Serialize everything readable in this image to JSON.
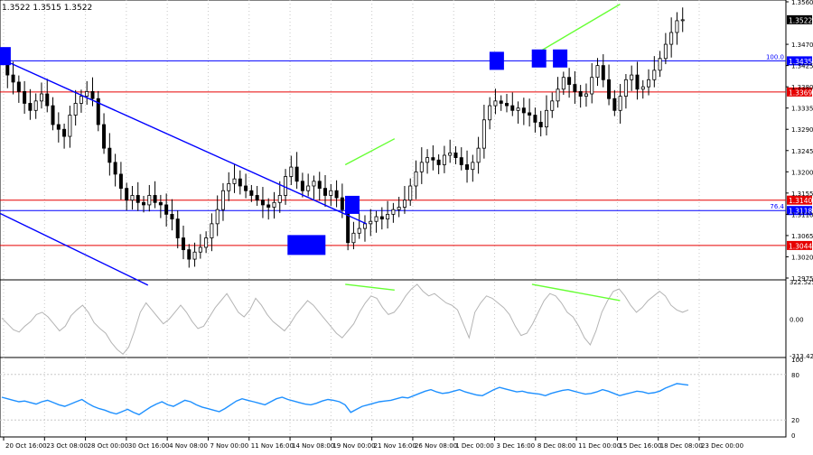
{
  "header": {
    "ohlc_text": "1.3522 1.3515 1.3522"
  },
  "colors": {
    "candle": "#000000",
    "blue_line": "#0000ff",
    "red_line": "#c8102e",
    "green_line": "#66ff33",
    "marker_fill": "#0000ff",
    "osc1_line": "#b4b4b4",
    "osc2_line": "#1e90ff",
    "label_bg_blue": "#0000ff",
    "label_bg_red": "#e60000",
    "label_bg_current": "#000000",
    "grid": "#c8c8c8"
  },
  "chart_data": [
    {
      "type": "candlestick",
      "ylim": [
        1.2975,
        1.356
      ],
      "y_ticks": [
        "1.3560",
        "1.3470",
        "1.3425",
        "1.3380",
        "1.3335",
        "1.3290",
        "1.3245",
        "1.3200",
        "1.3155",
        "1.3110",
        "1.3065",
        "1.3020",
        "1.2975"
      ],
      "current_price": "1.3522",
      "horizontal_levels": [
        {
          "price": 1.3435,
          "label": "1.3435",
          "prefix": "100.0",
          "color": "#0000ff"
        },
        {
          "price": 1.3369,
          "label": "1.3369",
          "color": "#e60000"
        },
        {
          "price": 1.314,
          "label": "1.3140",
          "color": "#e60000"
        },
        {
          "price": 1.3118,
          "label": "1.3118",
          "prefix": "76.4",
          "color": "#0000ff"
        },
        {
          "price": 1.3044,
          "label": "1.3044",
          "color": "#e60000"
        }
      ],
      "close_path": [
        1.3438,
        1.3405,
        1.339,
        1.337,
        1.3345,
        1.333,
        1.335,
        1.3365,
        1.334,
        1.33,
        1.329,
        1.3275,
        1.332,
        1.3345,
        1.336,
        1.337,
        1.3355,
        1.33,
        1.325,
        1.322,
        1.3195,
        1.3165,
        1.314,
        1.315,
        1.3135,
        1.313,
        1.315,
        1.3135,
        1.313,
        1.311,
        1.31,
        1.306,
        1.3035,
        1.3015,
        1.303,
        1.304,
        1.306,
        1.309,
        1.312,
        1.316,
        1.3175,
        1.3185,
        1.317,
        1.316,
        1.315,
        1.314,
        1.313,
        1.3125,
        1.3135,
        1.315,
        1.319,
        1.321,
        1.318,
        1.316,
        1.317,
        1.318,
        1.3165,
        1.315,
        1.316,
        1.3145,
        1.312,
        1.305,
        1.307,
        1.308,
        1.309,
        1.3095,
        1.3105,
        1.31,
        1.311,
        1.312,
        1.3125,
        1.314,
        1.317,
        1.32,
        1.322,
        1.323,
        1.3225,
        1.3215,
        1.3235,
        1.324,
        1.323,
        1.3215,
        1.3205,
        1.322,
        1.325,
        1.331,
        1.334,
        1.335,
        1.3345,
        1.334,
        1.333,
        1.3335,
        1.3325,
        1.332,
        1.3305,
        1.3295,
        1.333,
        1.335,
        1.3375,
        1.34,
        1.3385,
        1.337,
        1.336,
        1.3365,
        1.34,
        1.3425,
        1.3395,
        1.3355,
        1.333,
        1.336,
        1.3395,
        1.3405,
        1.3375,
        1.338,
        1.3395,
        1.3415,
        1.344,
        1.347,
        1.3495,
        1.352,
        1.3522
      ],
      "trend_lines": [
        {
          "kind": "upper-down-channel",
          "from": [
            0,
            1.344
          ],
          "to": [
            0.52,
            1.309
          ]
        },
        {
          "kind": "lower-down-channel",
          "from": [
            0,
            1.3112
          ],
          "to": [
            0.21,
            1.296
          ]
        },
        {
          "kind": "divergence",
          "from": [
            0.49,
            1.3215
          ],
          "to": [
            0.56,
            1.327
          ]
        },
        {
          "kind": "divergence",
          "from": [
            0.755,
            1.3445
          ],
          "to": [
            0.88,
            1.3555
          ]
        }
      ],
      "markers": [
        {
          "at": 0.005,
          "price": 1.3445
        },
        {
          "at": 0.435,
          "price": 1.3045
        },
        {
          "at": 0.5,
          "price": 1.313
        },
        {
          "at": 0.705,
          "price": 1.3435
        },
        {
          "at": 0.765,
          "price": 1.344
        },
        {
          "at": 0.795,
          "price": 1.344
        }
      ]
    },
    {
      "type": "line",
      "name": "oscillator",
      "ylim": [
        -313.422,
        322.5258
      ],
      "y_ticks": [
        "322.5258",
        "0.00",
        "-313.422"
      ],
      "values": [
        10,
        -40,
        -90,
        -110,
        -60,
        -20,
        40,
        60,
        20,
        -40,
        -100,
        -60,
        30,
        80,
        120,
        60,
        -30,
        -80,
        -120,
        -200,
        -260,
        -300,
        -240,
        -100,
        60,
        140,
        80,
        20,
        -40,
        0,
        60,
        120,
        60,
        -20,
        -80,
        -60,
        20,
        100,
        160,
        220,
        140,
        60,
        20,
        80,
        180,
        120,
        40,
        -20,
        -60,
        -100,
        -40,
        40,
        100,
        160,
        120,
        60,
        0,
        -60,
        -120,
        -160,
        -100,
        -40,
        60,
        140,
        200,
        180,
        100,
        40,
        60,
        120,
        200,
        260,
        300,
        240,
        200,
        220,
        180,
        140,
        120,
        80,
        -40,
        -160,
        60,
        140,
        200,
        180,
        140,
        100,
        40,
        -60,
        -140,
        -120,
        -40,
        60,
        160,
        220,
        200,
        140,
        60,
        20,
        -60,
        -160,
        -220,
        -100,
        60,
        160,
        240,
        260,
        200,
        120,
        60,
        100,
        160,
        200,
        240,
        200,
        120,
        80,
        60,
        80
      ]
    },
    {
      "type": "line",
      "name": "oscillator",
      "ylim": [
        0,
        100
      ],
      "y_ticks": [
        "100",
        "80",
        "20",
        "0"
      ],
      "values": [
        50,
        48,
        46,
        44,
        45,
        43,
        41,
        44,
        46,
        43,
        40,
        38,
        41,
        44,
        47,
        42,
        38,
        35,
        33,
        30,
        28,
        31,
        34,
        30,
        27,
        32,
        37,
        41,
        44,
        40,
        38,
        42,
        46,
        44,
        40,
        37,
        35,
        33,
        31,
        35,
        40,
        45,
        48,
        46,
        44,
        42,
        40,
        44,
        48,
        50,
        47,
        45,
        43,
        41,
        40,
        42,
        45,
        47,
        46,
        44,
        40,
        30,
        34,
        38,
        40,
        42,
        44,
        45,
        46,
        48,
        50,
        49,
        52,
        55,
        58,
        60,
        57,
        55,
        56,
        58,
        60,
        57,
        55,
        53,
        52,
        56,
        60,
        63,
        61,
        59,
        57,
        58,
        56,
        55,
        54,
        52,
        55,
        57,
        59,
        60,
        58,
        56,
        54,
        55,
        57,
        60,
        58,
        55,
        52,
        54,
        56,
        58,
        57,
        55,
        56,
        58,
        62,
        65,
        68,
        67,
        66
      ]
    }
  ],
  "x_axis": {
    "labels": [
      "20 Oct 16:00",
      "23 Oct 08:00",
      "28 Oct 00:00",
      "30 Oct 16:00",
      "4 Nov 08:00",
      "7 Nov 00:00",
      "11 Nov 16:00",
      "14 Nov 08:00",
      "19 Nov 00:00",
      "21 Nov 16:00",
      "26 Nov 08:00",
      "1 Dec 00:00",
      "3 Dec 16:00",
      "8 Dec 08:00",
      "11 Dec 00:00",
      "15 Dec 16:00",
      "18 Dec 08:00",
      "23 Dec 00:00"
    ]
  }
}
